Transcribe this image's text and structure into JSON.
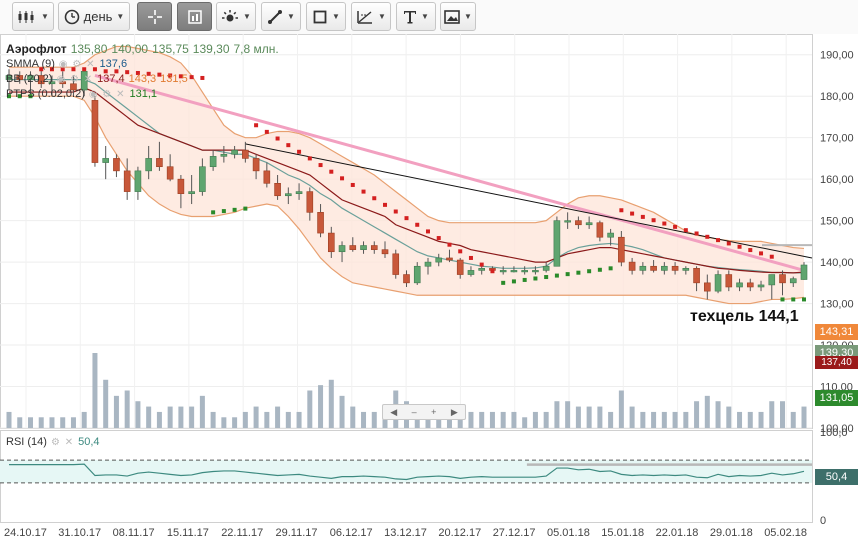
{
  "toolbar": {
    "period_label": "день",
    "buttons": [
      "candles-icon",
      "clock-icon",
      "crosshair-icon",
      "layout-icon",
      "indicators-icon",
      "line-tool-icon",
      "shape-tool-icon",
      "fib-tool-icon",
      "text-tool-icon",
      "image-tool-icon"
    ]
  },
  "legend": {
    "symbol": "Аэрофлот",
    "open": "135,80",
    "high": "140,00",
    "low": "135,75",
    "close": "139,30",
    "volume": "7,8 млн.",
    "smma_label": "SMMA (9)",
    "smma_value": "137,6",
    "bb_label": "BB (20,2)",
    "bb_mid": "137,4",
    "bb_upper": "143,3",
    "bb_lower": "131,5",
    "ptps_label": "PTPS (0.02,0.2)",
    "ptps_value": "131,1",
    "rsi_label": "RSI (14)",
    "rsi_value": "50,4"
  },
  "annotation": "техцель 144,1",
  "price_tags": [
    {
      "text": "143,31",
      "color": "#f0883a"
    },
    {
      "text": "139,30",
      "color": "#7a9a7a"
    },
    {
      "text": "137,40",
      "color": "#9b1b1b"
    },
    {
      "text": "131,05",
      "color": "#2d8a2d"
    },
    {
      "text": "50,4",
      "color": "#3d6f6a"
    }
  ],
  "colors": {
    "up": "#5fa56f",
    "down": "#c8583a",
    "bb_fill": "#fde4d8",
    "bb_line": "#e8a070",
    "smma": "#8b1a1a",
    "bb_mid": "#6aa09a",
    "sar_up": "#2a8a2a",
    "sar_down": "#d42020",
    "trend_pink": "#f2a0c0",
    "trend_black": "#111111",
    "volume": "#a9b6c2",
    "rsi_line": "#3d8a80",
    "rsi_fill": "#e6f7f5"
  },
  "chart_data": {
    "type": "candlestick",
    "y_ticks": [
      "100,00",
      "110,00",
      "120,00",
      "130,00",
      "140,00",
      "150,00",
      "160,00",
      "170,00",
      "180,00",
      "190,00"
    ],
    "ylim": [
      100,
      195
    ],
    "x_ticks": [
      "24.10.17",
      "31.10.17",
      "08.11.17",
      "15.11.17",
      "22.11.17",
      "29.11.17",
      "06.12.17",
      "13.12.17",
      "20.12.17",
      "27.12.17",
      "05.01.18",
      "15.01.18",
      "22.01.18",
      "29.01.18",
      "05.02.18"
    ],
    "candles": [
      [
        184.0,
        186.5,
        181.5,
        185.0
      ],
      [
        185.0,
        186.0,
        183.0,
        184.0
      ],
      [
        184.0,
        186.0,
        180.0,
        185.0
      ],
      [
        185.0,
        186.5,
        182.0,
        183.0
      ],
      [
        183.0,
        185.0,
        180.0,
        183.5
      ],
      [
        183.5,
        186.0,
        182.0,
        183.0
      ],
      [
        183.0,
        185.0,
        180.0,
        181.5
      ],
      [
        181.5,
        186.0,
        180.0,
        186.0
      ],
      [
        179.0,
        180.0,
        163.0,
        164.0
      ],
      [
        164.0,
        168.0,
        160.0,
        165.0
      ],
      [
        165.0,
        166.0,
        160.5,
        162.0
      ],
      [
        162.0,
        165.0,
        155.0,
        157.0
      ],
      [
        157.0,
        163.0,
        155.0,
        162.0
      ],
      [
        162.0,
        168.0,
        160.0,
        165.0
      ],
      [
        165.0,
        169.0,
        162.0,
        163.0
      ],
      [
        163.0,
        166.0,
        159.5,
        160.0
      ],
      [
        160.0,
        161.0,
        153.0,
        156.5
      ],
      [
        156.5,
        161.0,
        154.0,
        157.0
      ],
      [
        157.0,
        165.0,
        156.0,
        163.0
      ],
      [
        163.0,
        167.0,
        162.0,
        165.5
      ],
      [
        165.5,
        168.0,
        164.0,
        166.0
      ],
      [
        166.0,
        168.0,
        165.0,
        167.0
      ],
      [
        167.0,
        169.0,
        164.0,
        165.0
      ],
      [
        165.0,
        166.0,
        160.0,
        162.0
      ],
      [
        162.0,
        164.0,
        158.0,
        159.0
      ],
      [
        159.0,
        161.0,
        155.0,
        156.0
      ],
      [
        156.0,
        158.0,
        154.0,
        156.5
      ],
      [
        156.5,
        159.0,
        155.0,
        157.0
      ],
      [
        157.0,
        158.0,
        150.0,
        152.0
      ],
      [
        152.0,
        154.0,
        146.0,
        147.0
      ],
      [
        147.0,
        148.5,
        141.0,
        142.5
      ],
      [
        142.5,
        145.0,
        140.0,
        144.0
      ],
      [
        144.0,
        146.0,
        142.5,
        143.0
      ],
      [
        143.0,
        145.0,
        142.0,
        144.0
      ],
      [
        144.0,
        145.0,
        142.0,
        143.0
      ],
      [
        143.0,
        145.0,
        141.0,
        142.0
      ],
      [
        142.0,
        143.0,
        136.0,
        137.0
      ],
      [
        137.0,
        138.0,
        134.0,
        135.0
      ],
      [
        135.0,
        140.0,
        134.5,
        139.0
      ],
      [
        139.0,
        141.0,
        137.0,
        140.0
      ],
      [
        140.0,
        142.0,
        139.0,
        141.0
      ],
      [
        141.0,
        143.0,
        140.0,
        140.5
      ],
      [
        140.5,
        141.0,
        136.0,
        137.0
      ],
      [
        137.0,
        139.0,
        136.5,
        138.0
      ],
      [
        138.0,
        139.5,
        137.0,
        138.5
      ],
      [
        138.5,
        139.0,
        137.5,
        138.0
      ],
      [
        138.0,
        139.0,
        137.0,
        138.0
      ],
      [
        138.0,
        139.0,
        137.5,
        138.0
      ],
      [
        138.0,
        139.0,
        137.0,
        138.0
      ],
      [
        138.0,
        139.0,
        137.0,
        138.0
      ],
      [
        138.0,
        140.0,
        137.5,
        139.0
      ],
      [
        139.0,
        151.0,
        139.0,
        150.0
      ],
      [
        150.0,
        152.0,
        148.0,
        150.0
      ],
      [
        150.0,
        151.0,
        148.0,
        149.0
      ],
      [
        149.0,
        151.0,
        148.0,
        149.5
      ],
      [
        149.5,
        150.0,
        145.0,
        146.0
      ],
      [
        146.0,
        148.0,
        144.0,
        147.0
      ],
      [
        146.0,
        147.5,
        139.0,
        140.0
      ],
      [
        140.0,
        141.0,
        137.0,
        138.0
      ],
      [
        138.0,
        140.0,
        137.0,
        139.0
      ],
      [
        139.0,
        140.5,
        137.5,
        138.0
      ],
      [
        138.0,
        140.0,
        137.0,
        139.0
      ],
      [
        139.0,
        140.0,
        137.0,
        138.0
      ],
      [
        138.0,
        139.0,
        137.0,
        138.5
      ],
      [
        138.5,
        139.0,
        133.0,
        135.0
      ],
      [
        135.0,
        137.0,
        131.0,
        133.0
      ],
      [
        133.0,
        138.0,
        132.5,
        137.0
      ],
      [
        137.0,
        138.0,
        133.0,
        134.0
      ],
      [
        134.0,
        136.0,
        133.0,
        135.0
      ],
      [
        135.0,
        136.0,
        133.0,
        134.0
      ],
      [
        134.0,
        135.5,
        133.0,
        134.5
      ],
      [
        134.5,
        137.0,
        131.0,
        137.0
      ],
      [
        137.0,
        138.0,
        132.0,
        135.0
      ],
      [
        135.0,
        136.5,
        134.0,
        136.0
      ],
      [
        135.8,
        140.0,
        135.75,
        139.3
      ]
    ],
    "smma": [
      181,
      181,
      181,
      181,
      181,
      181,
      181,
      182,
      181,
      179,
      177,
      175,
      173,
      172,
      171,
      170,
      169,
      168,
      167,
      167,
      167,
      167,
      167,
      166,
      165,
      164,
      163,
      162,
      161,
      159,
      157,
      155,
      154,
      153,
      152,
      151,
      149,
      148,
      147,
      146,
      145,
      144.5,
      144,
      143,
      142.5,
      142,
      141.5,
      141,
      140.5,
      140,
      140,
      141,
      142,
      142.5,
      143,
      143.5,
      143.5,
      143,
      142.5,
      142,
      141.5,
      141,
      140.5,
      140,
      139.5,
      139,
      138.5,
      138.3,
      138,
      137.8,
      137.6,
      137.5,
      137.5,
      137.4,
      137.6
    ],
    "bb_mid": [
      184,
      184,
      184,
      184,
      184,
      184,
      184,
      184,
      183,
      181,
      179,
      177,
      175,
      173,
      171,
      170,
      169,
      168,
      167,
      167,
      166.5,
      166,
      166,
      165,
      164,
      162.5,
      161,
      160,
      158.5,
      156.5,
      155,
      153,
      151.5,
      150,
      148.5,
      147,
      145.5,
      144,
      142.5,
      141.5,
      141,
      140.5,
      140,
      139.5,
      139,
      138.8,
      138.5,
      138.5,
      138.5,
      138.6,
      139,
      141,
      142.5,
      143.5,
      144,
      144.3,
      144.5,
      144.2,
      143.7,
      143,
      142,
      141,
      140.5,
      140,
      139.5,
      139,
      138.7,
      138.4,
      138.2,
      138,
      137.8,
      137.5,
      137.5,
      137.4,
      137.4
    ],
    "bb_upper": [
      187,
      187,
      187,
      187,
      187,
      187,
      187,
      188,
      190,
      191,
      192,
      192,
      191.5,
      191,
      190.5,
      189.5,
      188,
      185,
      181,
      177,
      173,
      171,
      170,
      170,
      171,
      171.5,
      171.5,
      171,
      170,
      168.5,
      167,
      165.5,
      164,
      162.5,
      161,
      159,
      157,
      155,
      153,
      151,
      150,
      149.5,
      149.5,
      149.5,
      149.5,
      149.5,
      149.5,
      149.5,
      149.5,
      149.5,
      150,
      152,
      154,
      155.5,
      156,
      156,
      155.5,
      155,
      154,
      153,
      152,
      150.5,
      149,
      147.5,
      146.5,
      146,
      145.5,
      145.2,
      145,
      145,
      145,
      144.5,
      144,
      143.5,
      143.3
    ],
    "bb_lower": [
      180,
      180,
      180,
      180,
      180,
      180,
      180,
      179,
      175,
      170,
      166,
      162,
      159,
      156,
      154,
      152.5,
      151.5,
      151,
      151,
      151,
      151.5,
      152,
      153,
      153.5,
      154,
      153.5,
      151,
      148,
      144.5,
      141,
      138.5,
      136.5,
      135,
      134.5,
      134,
      133.5,
      133,
      132.5,
      132,
      132,
      132,
      132,
      132,
      132,
      132,
      132,
      132,
      132,
      132,
      132,
      132,
      132,
      132,
      132,
      132,
      132,
      132,
      132,
      132,
      132,
      132,
      132,
      132,
      132,
      131.5,
      131,
      130.5,
      130,
      130,
      130,
      130.5,
      131,
      131,
      131.2,
      131.5
    ],
    "volume": [
      3,
      2,
      2,
      2,
      2,
      2,
      2,
      3,
      14,
      9,
      6,
      7,
      5,
      4,
      3,
      4,
      4,
      4,
      6,
      3,
      2,
      2,
      3,
      4,
      3,
      4,
      3,
      3,
      7,
      8,
      9,
      6,
      4,
      3,
      3,
      3,
      7,
      5,
      3,
      4,
      3,
      3,
      4,
      3,
      3,
      3,
      3,
      3,
      2,
      3,
      3,
      5,
      5,
      4,
      4,
      4,
      3,
      7,
      4,
      3,
      3,
      3,
      3,
      3,
      5,
      6,
      5,
      4,
      3,
      3,
      3,
      5,
      5,
      3,
      4
    ],
    "rsi": [
      62,
      62,
      62,
      62,
      62,
      62,
      62,
      63,
      43,
      44,
      44,
      42,
      47,
      49,
      47,
      45,
      43,
      44,
      48,
      50,
      51,
      51,
      49,
      47,
      45,
      43,
      44,
      45,
      42,
      40,
      38,
      41,
      41,
      42,
      41,
      40,
      37,
      36,
      40,
      41,
      42,
      41,
      38,
      40,
      41,
      40,
      40,
      40,
      40,
      40,
      42,
      56,
      56,
      53,
      54,
      50,
      51,
      45,
      43,
      44,
      43,
      44,
      43,
      44,
      40,
      39,
      45,
      41,
      43,
      42,
      43,
      47,
      44,
      46,
      50.4
    ],
    "rsi_ylim": [
      0,
      100
    ],
    "rsi_levels": [
      30,
      70
    ],
    "rsi_ticks": [
      "0",
      "50",
      "100,0"
    ],
    "trendline_black": {
      "from": [
        22,
        168.5
      ],
      "to": [
        74,
        141
      ]
    },
    "trendline_pink": {
      "from": [
        8,
        185
      ],
      "to": [
        74,
        138
      ]
    },
    "target_level": 144.1,
    "rsi_hline": 62
  }
}
